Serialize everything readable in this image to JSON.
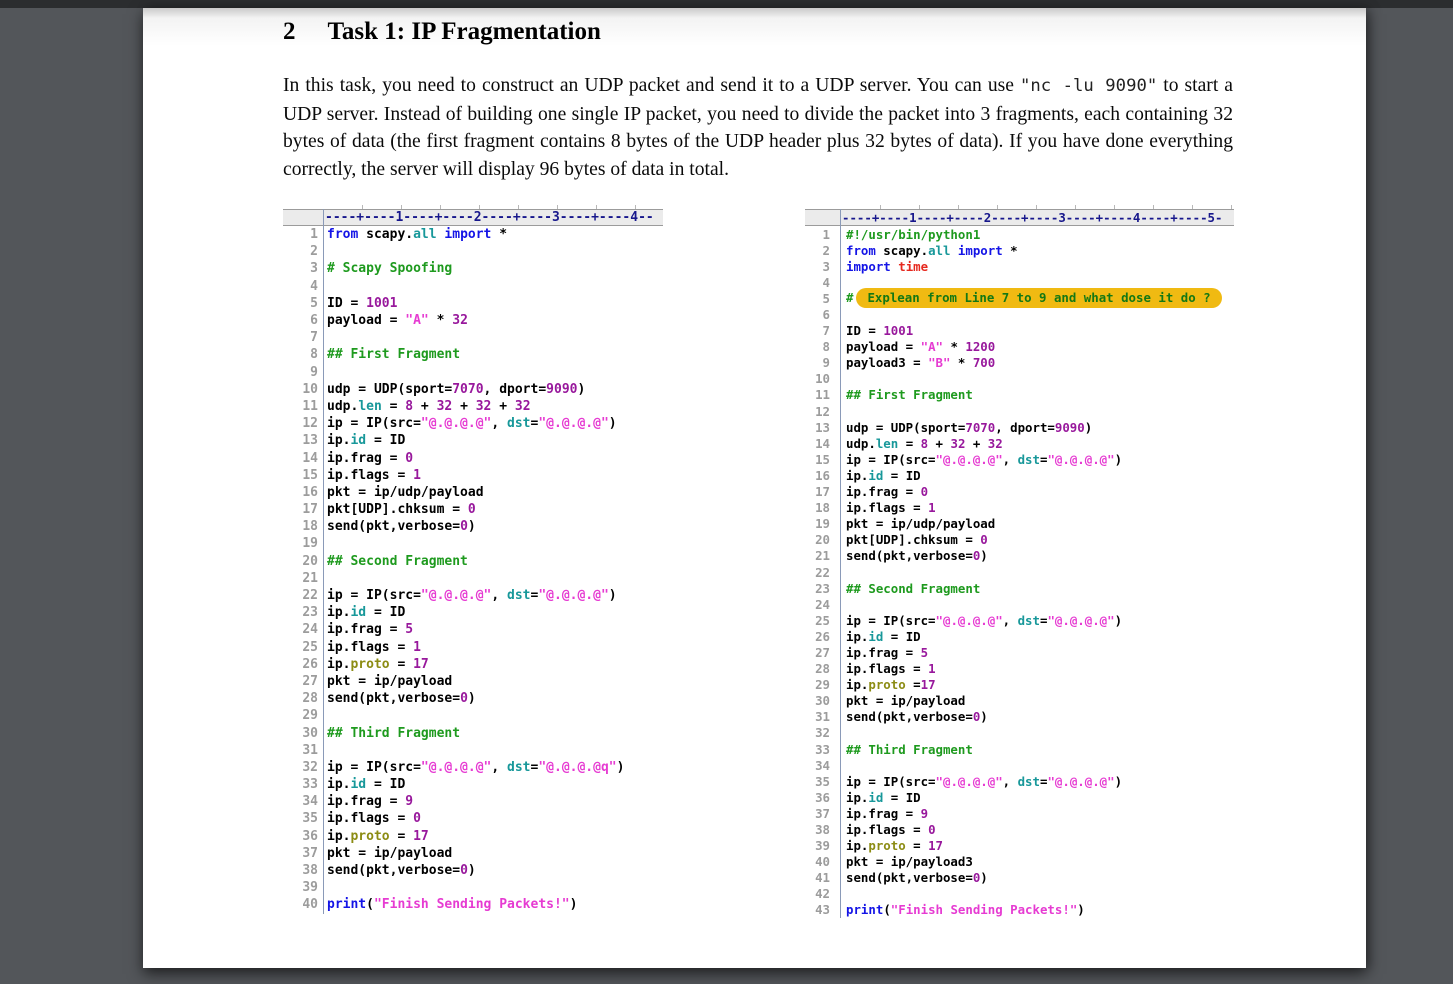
{
  "page": {
    "section_number": "2",
    "section_title": "Task 1: IP Fragmentation",
    "paragraph": [
      {
        "text": "In this task, you need to construct an UDP packet and send it to a UDP server.  You can use ",
        "mono": false
      },
      {
        "text": "\"nc -lu 9090\"",
        "mono": true
      },
      {
        "text": " to start a UDP server. Instead of building one single IP packet, you need to divide the packet into 3 fragments, each containing 32 bytes of data (the first fragment contains 8 bytes of the UDP header plus 32 bytes of data). If you have done everything correctly, the server will display 96 bytes of data in total.",
        "mono": false
      }
    ]
  },
  "colors": {
    "keyword_blue": "#1414e6",
    "comment_green": "#1e9a1e",
    "string_magenta": "#e63bd2",
    "number_purple": "#98189c",
    "builtin_teal": "#18989a",
    "proto_olive": "#8c8c14",
    "module_red": "#e6281e",
    "ruler_navy": "#17178c",
    "line_number_gray": "#9c9c9c",
    "highlight_yellow": "#f0ba12",
    "highlight_text_green": "#147814",
    "page_white": "#ffffff",
    "backdrop_gray": "#53565a"
  },
  "panels": [
    {
      "id": "left-code-listing",
      "ruler": "----+----1----+----2----+----3----+----4--",
      "lines": [
        [
          [
            "k",
            "from"
          ],
          [
            "d",
            " scapy."
          ],
          [
            "b",
            "all"
          ],
          [
            "d",
            " "
          ],
          [
            "k",
            "import"
          ],
          [
            "d",
            " *"
          ]
        ],
        [],
        [
          [
            "c",
            "# Scapy Spoofing"
          ]
        ],
        [],
        [
          [
            "d",
            "ID = "
          ],
          [
            "n",
            "1001"
          ]
        ],
        [
          [
            "d",
            "payload = "
          ],
          [
            "s",
            "\"A\""
          ],
          [
            "d",
            " * "
          ],
          [
            "n",
            "32"
          ]
        ],
        [],
        [
          [
            "c",
            "## First Fragment"
          ]
        ],
        [],
        [
          [
            "d",
            "udp = UDP(sport="
          ],
          [
            "n",
            "7070"
          ],
          [
            "d",
            ", dport="
          ],
          [
            "n",
            "9090"
          ],
          [
            "d",
            ")"
          ]
        ],
        [
          [
            "d",
            "udp."
          ],
          [
            "b",
            "len"
          ],
          [
            "d",
            " = "
          ],
          [
            "n",
            "8"
          ],
          [
            "d",
            " + "
          ],
          [
            "n",
            "32"
          ],
          [
            "d",
            " + "
          ],
          [
            "n",
            "32"
          ],
          [
            "d",
            " + "
          ],
          [
            "n",
            "32"
          ]
        ],
        [
          [
            "d",
            "ip = IP(src="
          ],
          [
            "s",
            "\"@.@.@.@\""
          ],
          [
            "d",
            ", "
          ],
          [
            "b",
            "dst"
          ],
          [
            "d",
            "="
          ],
          [
            "s",
            "\"@.@.@.@\""
          ],
          [
            "d",
            ")"
          ]
        ],
        [
          [
            "d",
            "ip."
          ],
          [
            "b",
            "id"
          ],
          [
            "d",
            " = ID"
          ]
        ],
        [
          [
            "d",
            "ip.frag = "
          ],
          [
            "n",
            "0"
          ]
        ],
        [
          [
            "d",
            "ip.flags = "
          ],
          [
            "n",
            "1"
          ]
        ],
        [
          [
            "d",
            "pkt = ip/udp/payload"
          ]
        ],
        [
          [
            "d",
            "pkt[UDP].chksum = "
          ],
          [
            "n",
            "0"
          ]
        ],
        [
          [
            "d",
            "send(pkt,verbose="
          ],
          [
            "n",
            "0"
          ],
          [
            "d",
            ")"
          ]
        ],
        [],
        [
          [
            "c",
            "## Second Fragment"
          ]
        ],
        [],
        [
          [
            "d",
            "ip = IP(src="
          ],
          [
            "s",
            "\"@.@.@.@\""
          ],
          [
            "d",
            ", "
          ],
          [
            "b",
            "dst"
          ],
          [
            "d",
            "="
          ],
          [
            "s",
            "\"@.@.@.@\""
          ],
          [
            "d",
            ")"
          ]
        ],
        [
          [
            "d",
            "ip."
          ],
          [
            "b",
            "id"
          ],
          [
            "d",
            " = ID"
          ]
        ],
        [
          [
            "d",
            "ip.frag = "
          ],
          [
            "n",
            "5"
          ]
        ],
        [
          [
            "d",
            "ip.flags = "
          ],
          [
            "n",
            "1"
          ]
        ],
        [
          [
            "d",
            "ip."
          ],
          [
            "o",
            "proto"
          ],
          [
            "d",
            " = "
          ],
          [
            "n",
            "17"
          ]
        ],
        [
          [
            "d",
            "pkt = ip/payload"
          ]
        ],
        [
          [
            "d",
            "send(pkt,verbose="
          ],
          [
            "n",
            "0"
          ],
          [
            "d",
            ")"
          ]
        ],
        [],
        [
          [
            "c",
            "## Third Fragment"
          ]
        ],
        [],
        [
          [
            "d",
            "ip = IP(src="
          ],
          [
            "s",
            "\"@.@.@.@\""
          ],
          [
            "d",
            ", "
          ],
          [
            "b",
            "dst"
          ],
          [
            "d",
            "="
          ],
          [
            "s",
            "\"@.@.@.@q\""
          ],
          [
            "d",
            ")"
          ]
        ],
        [
          [
            "d",
            "ip."
          ],
          [
            "b",
            "id"
          ],
          [
            "d",
            " = ID"
          ]
        ],
        [
          [
            "d",
            "ip.frag = "
          ],
          [
            "n",
            "9"
          ]
        ],
        [
          [
            "d",
            "ip.flags = "
          ],
          [
            "n",
            "0"
          ]
        ],
        [
          [
            "d",
            "ip."
          ],
          [
            "o",
            "proto"
          ],
          [
            "d",
            " = "
          ],
          [
            "n",
            "17"
          ]
        ],
        [
          [
            "d",
            "pkt = ip/payload"
          ]
        ],
        [
          [
            "d",
            "send(pkt,verbose="
          ],
          [
            "n",
            "0"
          ],
          [
            "d",
            ")"
          ]
        ],
        [],
        [
          [
            "k",
            "print"
          ],
          [
            "d",
            "("
          ],
          [
            "s",
            "\"Finish Sending Packets!\""
          ],
          [
            "d",
            ")"
          ]
        ]
      ]
    },
    {
      "id": "right-code-listing",
      "ruler": "----+----1----+----2----+----3----+----4----+----5-",
      "lines": [
        [
          [
            "c",
            "#!/usr/bin/python1"
          ]
        ],
        [
          [
            "k",
            "from"
          ],
          [
            "d",
            " scapy."
          ],
          [
            "b",
            "all"
          ],
          [
            "d",
            " "
          ],
          [
            "k",
            "import"
          ],
          [
            "d",
            " *"
          ]
        ],
        [
          [
            "k",
            "import"
          ],
          [
            "d",
            " "
          ],
          [
            "r",
            "time"
          ]
        ],
        [],
        [
          [
            "c",
            "#"
          ],
          [
            "chl",
            "Explean from Line 7 to 9 and what dose it do ?"
          ]
        ],
        [],
        [
          [
            "d",
            "ID = "
          ],
          [
            "n",
            "1001"
          ]
        ],
        [
          [
            "d",
            "payload = "
          ],
          [
            "s",
            "\"A\""
          ],
          [
            "d",
            " * "
          ],
          [
            "n",
            "1200"
          ]
        ],
        [
          [
            "d",
            "payload3 = "
          ],
          [
            "s",
            "\"B\""
          ],
          [
            "d",
            " * "
          ],
          [
            "n",
            "700"
          ]
        ],
        [],
        [
          [
            "c",
            "## First Fragment"
          ]
        ],
        [],
        [
          [
            "d",
            "udp = UDP(sport="
          ],
          [
            "n",
            "7070"
          ],
          [
            "d",
            ", dport="
          ],
          [
            "n",
            "9090"
          ],
          [
            "d",
            ")"
          ]
        ],
        [
          [
            "d",
            "udp."
          ],
          [
            "b",
            "len"
          ],
          [
            "d",
            " = "
          ],
          [
            "n",
            "8"
          ],
          [
            "d",
            " + "
          ],
          [
            "n",
            "32"
          ],
          [
            "d",
            " + "
          ],
          [
            "n",
            "32"
          ]
        ],
        [
          [
            "d",
            "ip = IP(src="
          ],
          [
            "s",
            "\"@.@.@.@\""
          ],
          [
            "d",
            ", "
          ],
          [
            "b",
            "dst"
          ],
          [
            "d",
            "="
          ],
          [
            "s",
            "\"@.@.@.@\""
          ],
          [
            "d",
            ")"
          ]
        ],
        [
          [
            "d",
            "ip."
          ],
          [
            "b",
            "id"
          ],
          [
            "d",
            " = ID"
          ]
        ],
        [
          [
            "d",
            "ip.frag = "
          ],
          [
            "n",
            "0"
          ]
        ],
        [
          [
            "d",
            "ip.flags = "
          ],
          [
            "n",
            "1"
          ]
        ],
        [
          [
            "d",
            "pkt = ip/udp/payload"
          ]
        ],
        [
          [
            "d",
            "pkt[UDP].chksum = "
          ],
          [
            "n",
            "0"
          ]
        ],
        [
          [
            "d",
            "send(pkt,verbose="
          ],
          [
            "n",
            "0"
          ],
          [
            "d",
            ")"
          ]
        ],
        [],
        [
          [
            "c",
            "## Second Fragment"
          ]
        ],
        [],
        [
          [
            "d",
            "ip = IP(src="
          ],
          [
            "s",
            "\"@.@.@.@\""
          ],
          [
            "d",
            ", "
          ],
          [
            "b",
            "dst"
          ],
          [
            "d",
            "="
          ],
          [
            "s",
            "\"@.@.@.@\""
          ],
          [
            "d",
            ")"
          ]
        ],
        [
          [
            "d",
            "ip."
          ],
          [
            "b",
            "id"
          ],
          [
            "d",
            " = ID"
          ]
        ],
        [
          [
            "d",
            "ip.frag = "
          ],
          [
            "n",
            "5"
          ]
        ],
        [
          [
            "d",
            "ip.flags = "
          ],
          [
            "n",
            "1"
          ]
        ],
        [
          [
            "d",
            "ip."
          ],
          [
            "o",
            "proto"
          ],
          [
            "d",
            " ="
          ],
          [
            "n",
            "17"
          ]
        ],
        [
          [
            "d",
            "pkt = ip/payload"
          ]
        ],
        [
          [
            "d",
            "send(pkt,verbose="
          ],
          [
            "n",
            "0"
          ],
          [
            "d",
            ")"
          ]
        ],
        [],
        [
          [
            "c",
            "## Third Fragment"
          ]
        ],
        [],
        [
          [
            "d",
            "ip = IP(src="
          ],
          [
            "s",
            "\"@.@.@.@\""
          ],
          [
            "d",
            ", "
          ],
          [
            "b",
            "dst"
          ],
          [
            "d",
            "="
          ],
          [
            "s",
            "\"@.@.@.@\""
          ],
          [
            "d",
            ")"
          ]
        ],
        [
          [
            "d",
            "ip."
          ],
          [
            "b",
            "id"
          ],
          [
            "d",
            " = ID"
          ]
        ],
        [
          [
            "d",
            "ip.frag = "
          ],
          [
            "n",
            "9"
          ]
        ],
        [
          [
            "d",
            "ip.flags = "
          ],
          [
            "n",
            "0"
          ]
        ],
        [
          [
            "d",
            "ip."
          ],
          [
            "o",
            "proto"
          ],
          [
            "d",
            " = "
          ],
          [
            "n",
            "17"
          ]
        ],
        [
          [
            "d",
            "pkt = ip/payload3"
          ]
        ],
        [
          [
            "d",
            "send(pkt,verbose="
          ],
          [
            "n",
            "0"
          ],
          [
            "d",
            ")"
          ]
        ],
        [],
        [
          [
            "k",
            "print"
          ],
          [
            "d",
            "("
          ],
          [
            "s",
            "\"Finish Sending Packets!\""
          ],
          [
            "d",
            ")"
          ]
        ]
      ]
    }
  ]
}
